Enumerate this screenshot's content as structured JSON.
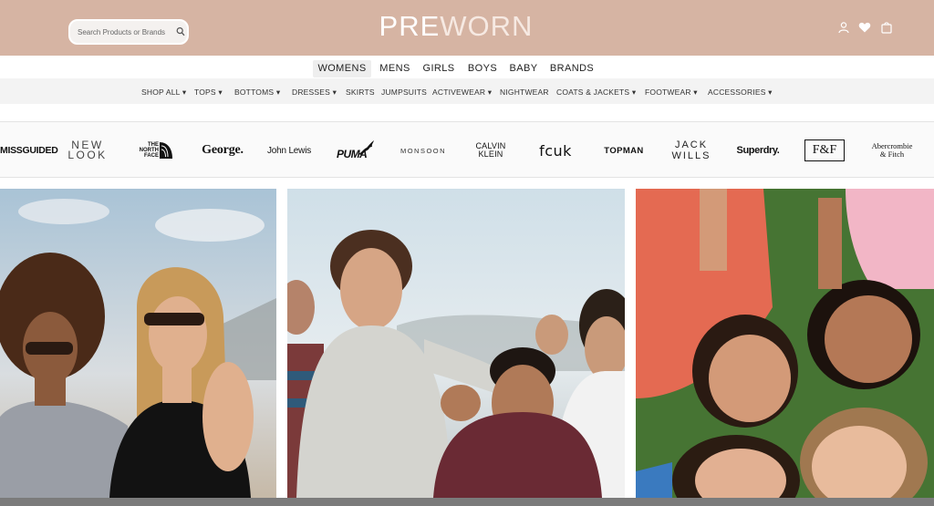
{
  "header": {
    "logo_pre": "PRE",
    "logo_worn": "WORN",
    "search_placeholder": "Search Products or Brands",
    "icons": [
      "search-icon",
      "account-icon",
      "heart-icon",
      "bag-icon"
    ]
  },
  "topnav": [
    "WOMENS",
    "MENS",
    "GIRLS",
    "BOYS",
    "BABY",
    "BRANDS"
  ],
  "subnav": [
    "SHOP ALL",
    "TOPS",
    "BOTTOMS",
    "DRESSES",
    "SKIRTS",
    "JUMPSUITS",
    "ACTIVEWEAR",
    "NIGHTWEAR",
    "COATS & JACKETS",
    "FOOTWEAR",
    "ACCESSORIES"
  ],
  "subnav_dropdown_marker": "▾",
  "brands": {
    "missguided": "MISSGUIDED",
    "newlook_1": "NEW",
    "newlook_2": "LOOK",
    "northface_1": "THE",
    "northface_2": "NORTH",
    "northface_3": "FACE",
    "george": "George.",
    "johnlewis": "John Lewis",
    "puma": "PUMA",
    "monsoon": "MONSOON",
    "calvin_1": "CALVIN",
    "calvin_2": "KLEIN",
    "fcuk": "fcuk",
    "topman": "TOPMAN",
    "jackwills_1": "JACK",
    "jackwills_2": "WILLS",
    "superdry": "Superdry.",
    "ff": "F&F",
    "af_1": "Abercrombie",
    "af_2": "& Fitch"
  },
  "colors": {
    "header_bg": "#d6b4a3",
    "subnav_bg": "#f3f3f3",
    "brand_strip_bg": "#fafafa",
    "bottom_bar": "#7b7b7b"
  }
}
